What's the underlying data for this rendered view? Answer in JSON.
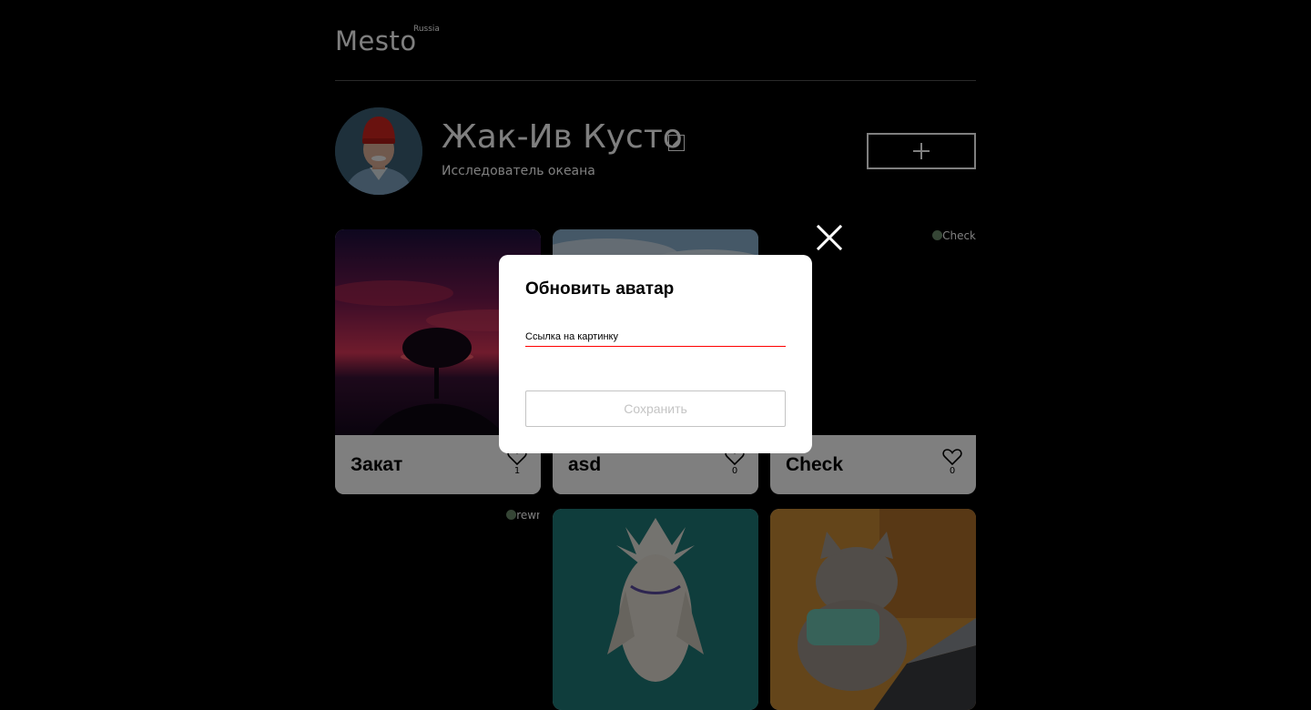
{
  "header": {
    "logo": "Mesto",
    "logo_sup": "Russia"
  },
  "profile": {
    "name": "Жак-Ив Кусто",
    "about": "Исследователь океана",
    "avatar_icon": "avatar-photo",
    "edit_icon": "pencil-icon",
    "add_icon": "plus-icon"
  },
  "cards": [
    {
      "title": "Закат",
      "likes": "1",
      "image": "sunset-tree"
    },
    {
      "title": "asd",
      "likes": "0",
      "image": "sky-clouds"
    },
    {
      "title": "Check",
      "likes": "0",
      "broken_alt": "Check"
    },
    {
      "broken_alt": "rewr"
    },
    {
      "image": "white-bird"
    },
    {
      "image": "cat-laptop"
    }
  ],
  "popup": {
    "title": "Обновить аватар",
    "input_placeholder": "Ссылка на картинку",
    "input_value": "",
    "save_label": "Сохранить",
    "close_icon": "close-icon"
  },
  "colors": {
    "background": "#000000",
    "input_error": "#ff0000",
    "disabled_text": "#c4c4c4"
  }
}
